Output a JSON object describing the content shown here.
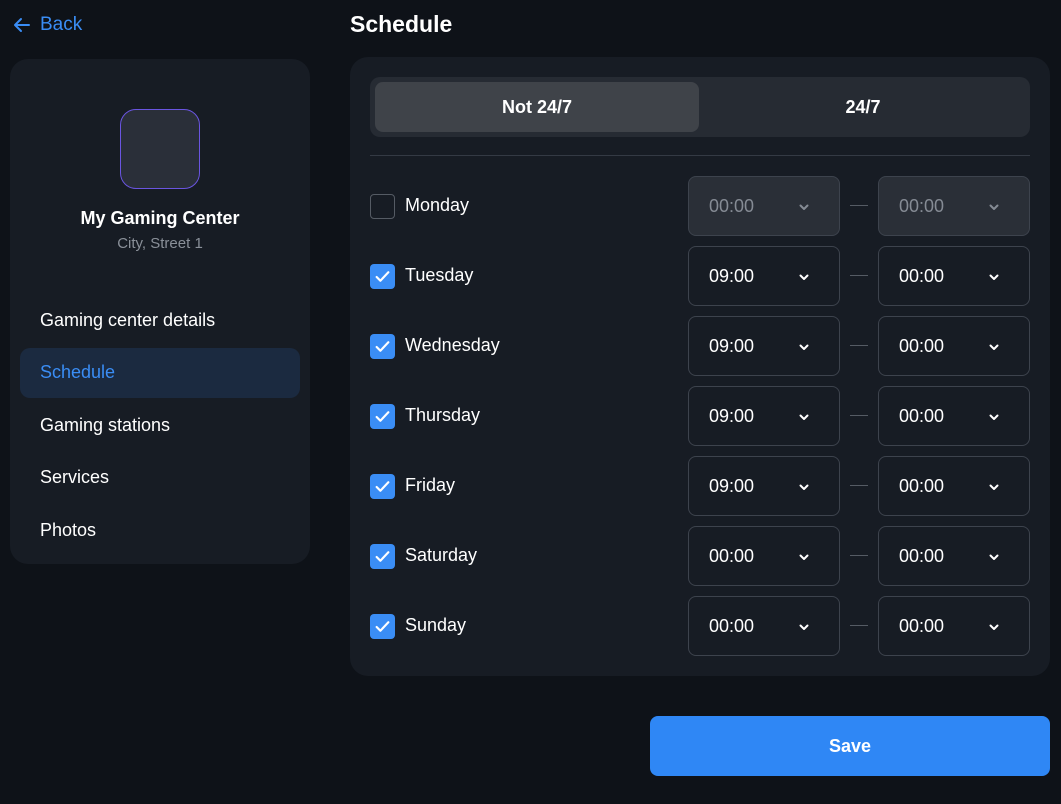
{
  "back_label": "Back",
  "sidebar": {
    "center_name": "My Gaming Center",
    "center_address": "City, Street 1",
    "nav": [
      {
        "label": "Gaming center details",
        "active": false
      },
      {
        "label": "Schedule",
        "active": true
      },
      {
        "label": "Gaming stations",
        "active": false
      },
      {
        "label": "Services",
        "active": false
      },
      {
        "label": "Photos",
        "active": false
      }
    ]
  },
  "page_title": "Schedule",
  "mode_toggle": {
    "options": [
      "Not 24/7",
      "24/7"
    ],
    "selected": "Not 24/7"
  },
  "days": [
    {
      "name": "Monday",
      "checked": false,
      "from": "00:00",
      "to": "00:00"
    },
    {
      "name": "Tuesday",
      "checked": true,
      "from": "09:00",
      "to": "00:00"
    },
    {
      "name": "Wednesday",
      "checked": true,
      "from": "09:00",
      "to": "00:00"
    },
    {
      "name": "Thursday",
      "checked": true,
      "from": "09:00",
      "to": "00:00"
    },
    {
      "name": "Friday",
      "checked": true,
      "from": "09:00",
      "to": "00:00"
    },
    {
      "name": "Saturday",
      "checked": true,
      "from": "00:00",
      "to": "00:00"
    },
    {
      "name": "Sunday",
      "checked": true,
      "from": "00:00",
      "to": "00:00"
    }
  ],
  "save_label": "Save",
  "colors": {
    "accent": "#3a8df5",
    "background": "#0e1218",
    "card": "#171c24",
    "avatar_border": "#6a55e0"
  }
}
